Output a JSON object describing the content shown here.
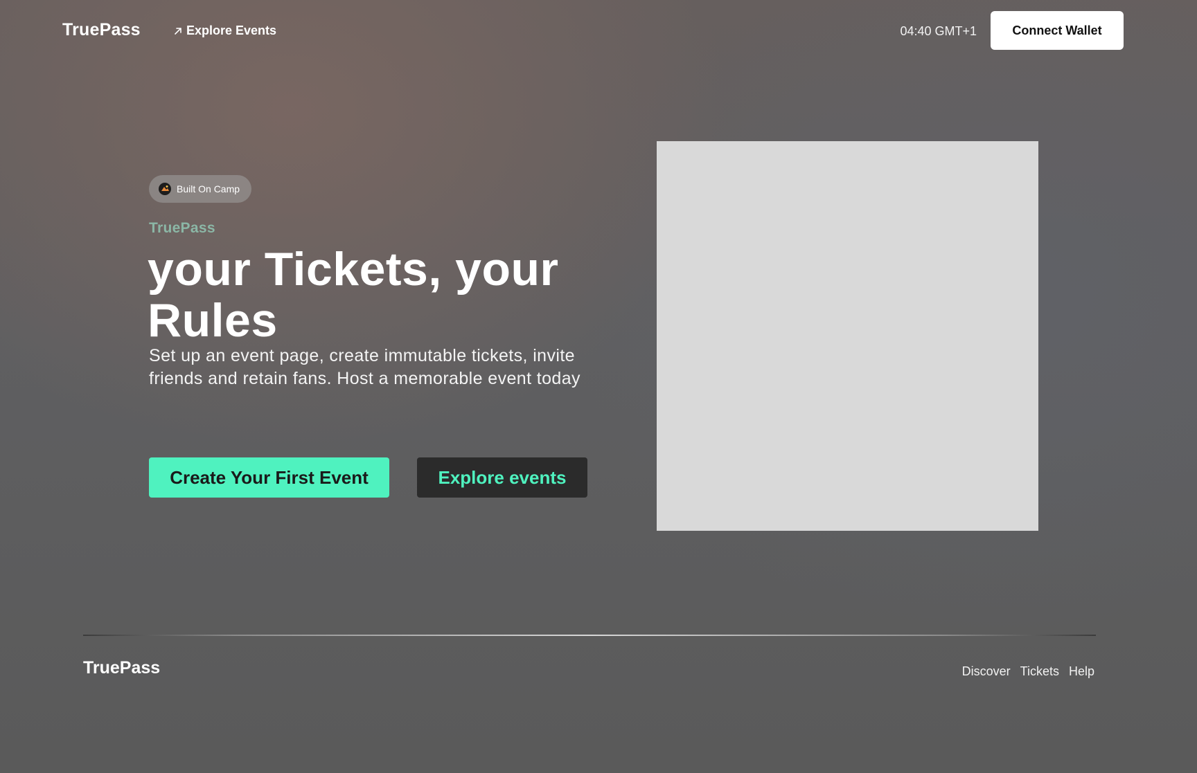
{
  "header": {
    "logo": "TruePass",
    "nav_link": "Explore Events",
    "clock": "04:40 GMT+1",
    "connect_button": "Connect Wallet"
  },
  "hero": {
    "badge_label": "Built On Camp",
    "brand": "TruePass",
    "headline": "your Tickets, your Rules",
    "subtext": "Set up an event page, create immutable tickets, invite friends and retain fans. Host a memorable event today",
    "primary_button": "Create Your First Event",
    "secondary_button": "Explore events"
  },
  "footer": {
    "logo": "TruePass",
    "links": [
      "Discover",
      "Tickets",
      "Help"
    ]
  },
  "colors": {
    "accent": "#4ff2bf",
    "brand_muted": "#8bb7a6",
    "image_placeholder": "#d9d9d9",
    "dark_button": "#2b2b2b"
  },
  "icons": {
    "nav_link_icon": "arrow-up-right-icon",
    "badge_icon": "camp-logo-icon"
  }
}
